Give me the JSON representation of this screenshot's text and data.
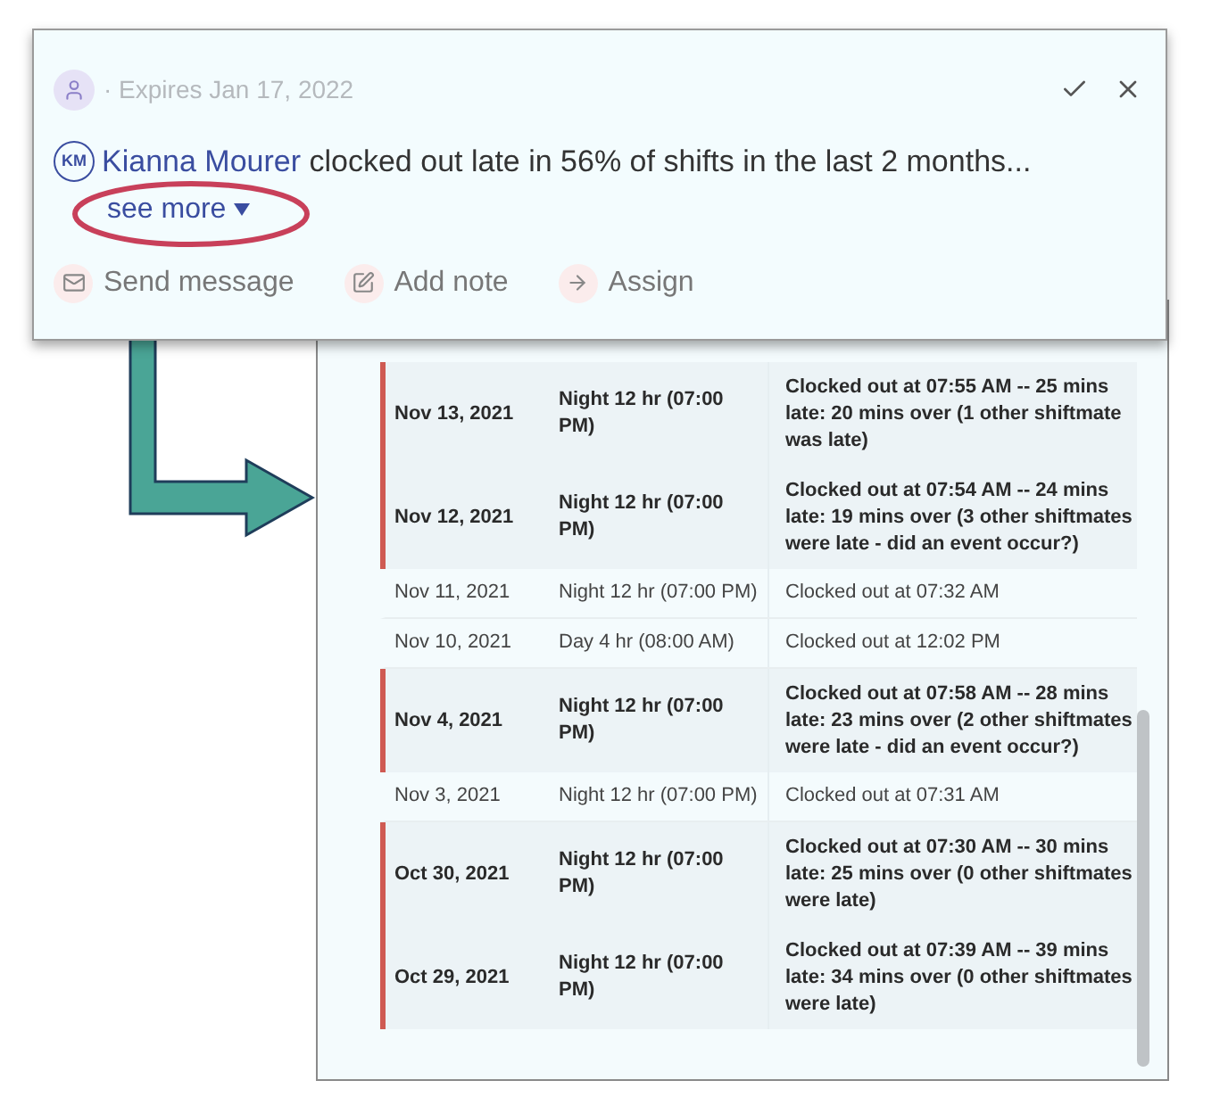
{
  "notification": {
    "expires": "· Expires Jan 17, 2022",
    "user_initials": "KM",
    "user_name": "Kianna Mourer",
    "message": "clocked out late in 56% of shifts in the last 2 months...",
    "see_more": "see more",
    "actions": [
      {
        "kind": "message",
        "label": "Send message"
      },
      {
        "kind": "note",
        "label": "Add note"
      },
      {
        "kind": "assign",
        "label": "Assign"
      }
    ]
  },
  "shifts": {
    "rows": [
      {
        "date": "Nov 13, 2021",
        "shift": "Night 12 hr (07:00 PM)",
        "detail": "Clocked out at 07:55 AM -- 25 mins late: 20 mins over (1 other shiftmate was late)",
        "late": true
      },
      {
        "date": "Nov 12, 2021",
        "shift": "Night 12 hr (07:00 PM)",
        "detail": "Clocked out at 07:54 AM -- 24 mins late: 19 mins over (3 other shiftmates were late - did an event occur?)",
        "late": true
      },
      {
        "date": "Nov 11, 2021",
        "shift": "Night 12 hr (07:00 PM)",
        "detail": "Clocked out at 07:32 AM",
        "late": false
      },
      {
        "date": "Nov 10, 2021",
        "shift": "Day 4 hr (08:00 AM)",
        "detail": "Clocked out at 12:02 PM",
        "late": false
      },
      {
        "date": "Nov 4, 2021",
        "shift": "Night 12 hr (07:00 PM)",
        "detail": "Clocked out at 07:58 AM -- 28 mins late: 23 mins over (2 other shiftmates were late - did an event occur?)",
        "late": true
      },
      {
        "date": "Nov 3, 2021",
        "shift": "Night 12 hr (07:00 PM)",
        "detail": "Clocked out at 07:31 AM",
        "late": false
      },
      {
        "date": "Oct 30, 2021",
        "shift": "Night 12 hr (07:00 PM)",
        "detail": "Clocked out at 07:30 AM -- 30 mins late: 25 mins over (0 other shiftmates were late)",
        "late": true
      },
      {
        "date": "Oct 29, 2021",
        "shift": "Night 12 hr (07:00 PM)",
        "detail": "Clocked out at 07:39 AM -- 39 mins late: 34 mins over (0 other shiftmates were late)",
        "late": true
      }
    ]
  }
}
